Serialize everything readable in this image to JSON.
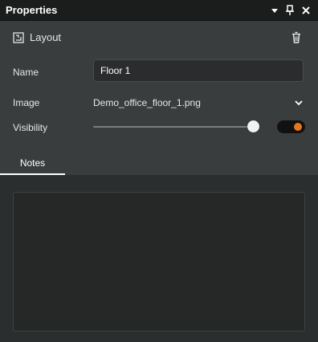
{
  "window": {
    "title": "Properties"
  },
  "section": {
    "title": "Layout"
  },
  "fields": {
    "name_label": "Name",
    "name_value": "Floor 1",
    "image_label": "Image",
    "image_value": "Demo_office_floor_1.png",
    "visibility_label": "Visibility",
    "visibility_slider_fraction": 0.97,
    "visibility_toggle_on": true
  },
  "tabs": [
    {
      "label": "Notes",
      "active": true
    }
  ],
  "notes": {
    "value": ""
  },
  "colors": {
    "accent": "#e8741e",
    "panel": "#3a3d3e",
    "titlebar": "#1b1c1c"
  },
  "icons": [
    "menu-dropdown-icon",
    "pin-icon",
    "close-icon",
    "layout-icon",
    "trash-icon",
    "chevron-down-icon"
  ]
}
